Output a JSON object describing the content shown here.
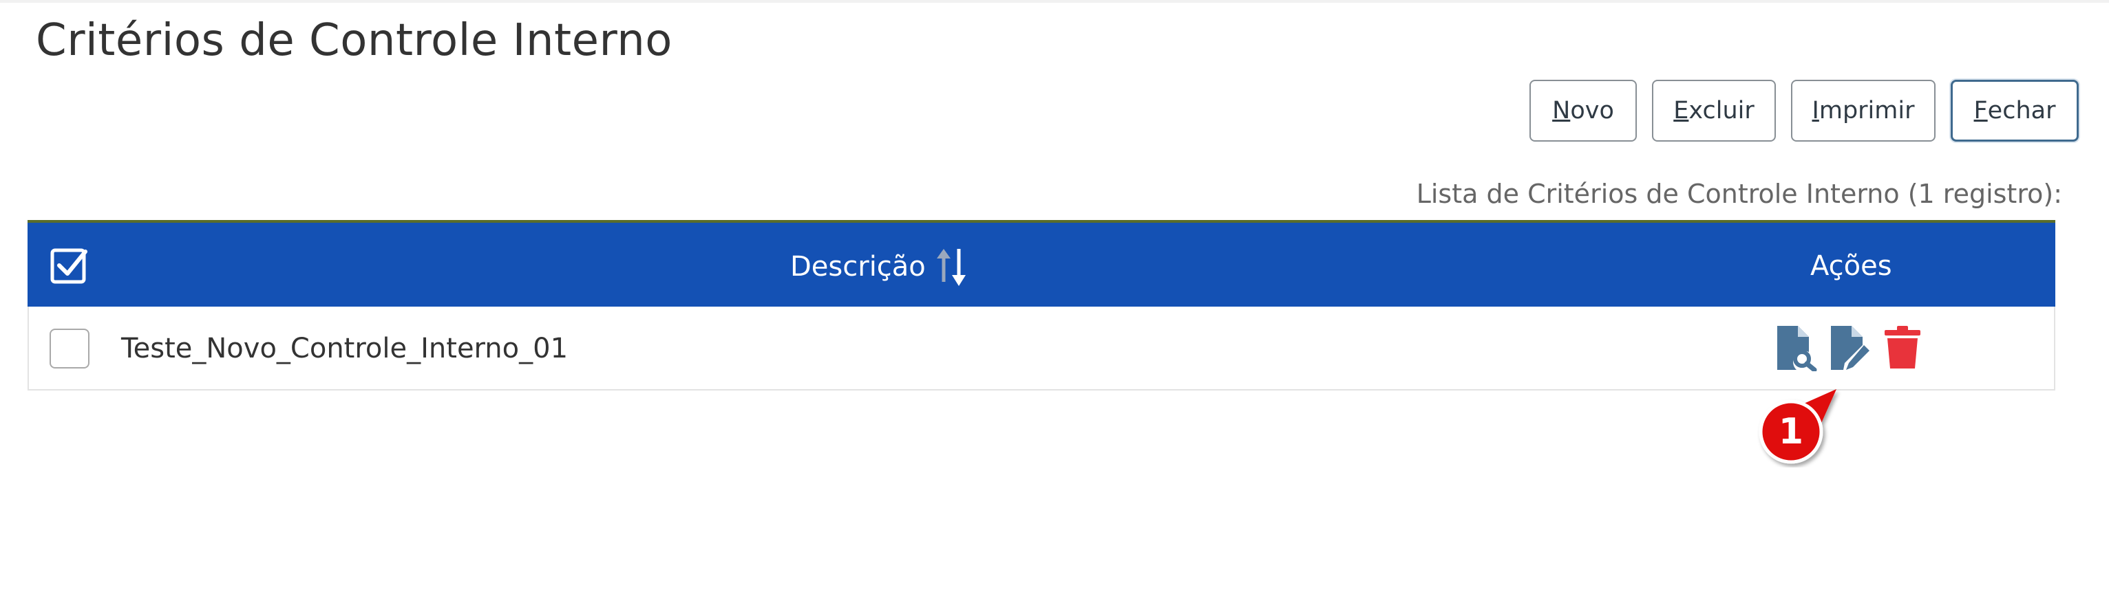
{
  "page": {
    "title": "Critérios de Controle Interno"
  },
  "toolbar": {
    "novo": {
      "accel": "N",
      "rest": "ovo"
    },
    "excluir": {
      "accel": "E",
      "rest": "xcluir"
    },
    "imprimir": {
      "accel": "I",
      "rest": "mprimir"
    },
    "fechar": {
      "accel": "F",
      "rest": "echar"
    }
  },
  "list": {
    "caption": "Lista de Critérios de Controle Interno (1 registro):",
    "columns": {
      "description": "Descrição",
      "actions": "Ações"
    },
    "rows": [
      {
        "description": "Teste_Novo_Controle_Interno_01",
        "checked": false
      }
    ]
  },
  "annotation": {
    "marker": "1"
  },
  "colors": {
    "header_bg": "#1451b4",
    "action_icon": "#4a7499",
    "delete_icon": "#e8333b",
    "callout": "#e00e0e"
  },
  "icons": {
    "select_all": "checkbox-checked-icon",
    "sort": "sort-arrows-icon",
    "view": "file-search-icon",
    "edit": "file-edit-icon",
    "delete": "trash-icon"
  }
}
